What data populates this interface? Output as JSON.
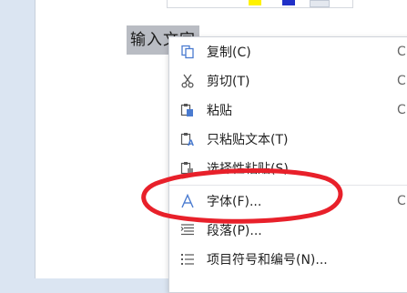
{
  "document": {
    "selected_text": "输入文字"
  },
  "colors": {
    "page_background": "#ffffff",
    "workspace_background": "#dbe5f2",
    "selection_highlight": "#b9bcc3",
    "annotation_red": "#e8202a"
  },
  "context_menu": {
    "items": [
      {
        "label": "复制(C)",
        "icon": "copy-icon",
        "shortcut": "C"
      },
      {
        "label": "剪切(T)",
        "icon": "scissors-icon",
        "shortcut": "C"
      },
      {
        "label": "粘贴",
        "icon": "paste-icon",
        "shortcut": "C"
      },
      {
        "label": "只粘贴文本(T)",
        "icon": "paste-text-icon",
        "shortcut": ""
      },
      {
        "label": "选择性粘贴(S)...",
        "icon": "paste-special-icon",
        "shortcut": ""
      },
      {
        "label": "字体(F)...",
        "icon": "font-icon",
        "shortcut": "C"
      },
      {
        "label": "段落(P)...",
        "icon": "paragraph-icon",
        "shortcut": ""
      },
      {
        "label": "项目符号和编号(N)...",
        "icon": "bullet-list-icon",
        "shortcut": ""
      }
    ]
  }
}
